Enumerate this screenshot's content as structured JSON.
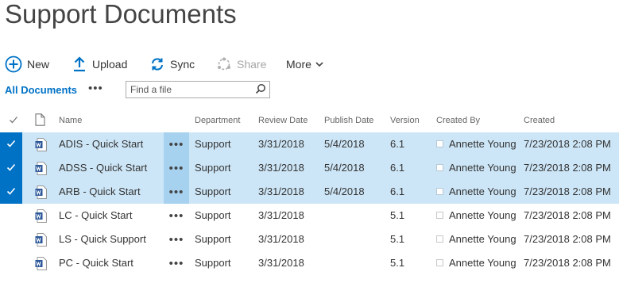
{
  "page": {
    "title": "Support Documents"
  },
  "commands": {
    "new": "New",
    "upload": "Upload",
    "sync": "Sync",
    "share": "Share",
    "more": "More"
  },
  "view": {
    "name": "All Documents",
    "more_dots": "•••",
    "search_placeholder": "Find a file"
  },
  "columns": {
    "name": "Name",
    "department": "Department",
    "review_date": "Review Date",
    "publish_date": "Publish Date",
    "version": "Version",
    "created_by": "Created By",
    "created": "Created"
  },
  "rows": [
    {
      "name": "ADIS - Quick Start",
      "department": "Support",
      "review_date": "3/31/2018",
      "publish_date": "5/4/2018",
      "version": "6.1",
      "created_by": "Annette Young",
      "created": "7/23/2018 2:08 PM",
      "selected": true
    },
    {
      "name": "ADSS - Quick Start",
      "department": "Support",
      "review_date": "3/31/2018",
      "publish_date": "5/4/2018",
      "version": "6.1",
      "created_by": "Annette Young",
      "created": "7/23/2018 2:08 PM",
      "selected": true
    },
    {
      "name": "ARB - Quick Start",
      "department": "Support",
      "review_date": "3/31/2018",
      "publish_date": "5/4/2018",
      "version": "6.1",
      "created_by": "Annette Young",
      "created": "7/23/2018 2:08 PM",
      "selected": true
    },
    {
      "name": "LC - Quick Start",
      "department": "Support",
      "review_date": "3/31/2018",
      "publish_date": "",
      "version": "5.1",
      "created_by": "Annette Young",
      "created": "7/23/2018 2:08 PM",
      "selected": false
    },
    {
      "name": "LS - Quick Support",
      "department": "Support",
      "review_date": "3/31/2018",
      "publish_date": "",
      "version": "5.1",
      "created_by": "Annette Young",
      "created": "7/23/2018 2:08 PM",
      "selected": false
    },
    {
      "name": "PC - Quick Start",
      "department": "Support",
      "review_date": "3/31/2018",
      "publish_date": "",
      "version": "5.1",
      "created_by": "Annette Young",
      "created": "7/23/2018 2:08 PM",
      "selected": false
    }
  ],
  "colors": {
    "accent": "#0072c6",
    "selected_row": "#cde6f7",
    "selected_dots": "#a6d1ef",
    "word_icon": "#2b579a"
  },
  "icons": {
    "file_type": "word-document-icon",
    "select": "checkmark-icon"
  }
}
